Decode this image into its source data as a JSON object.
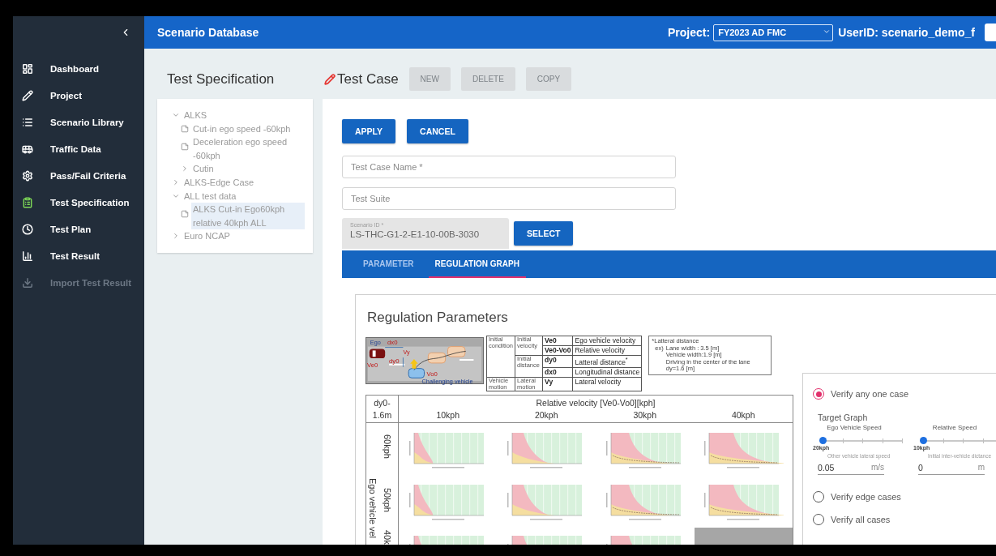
{
  "sidebar": {
    "items": [
      {
        "label": "Dashboard",
        "selected": false,
        "disabled": false
      },
      {
        "label": "Project",
        "selected": false,
        "disabled": false
      },
      {
        "label": "Scenario Library",
        "selected": false,
        "disabled": false
      },
      {
        "label": "Traffic Data",
        "selected": false,
        "disabled": false
      },
      {
        "label": "Pass/Fail Criteria",
        "selected": false,
        "disabled": false
      },
      {
        "label": "Test Specification",
        "selected": true,
        "disabled": false
      },
      {
        "label": "Test Plan",
        "selected": false,
        "disabled": false
      },
      {
        "label": "Test Result",
        "selected": false,
        "disabled": false
      },
      {
        "label": "Import Test Result",
        "selected": false,
        "disabled": true
      }
    ]
  },
  "header": {
    "title": "Scenario Database",
    "project_label": "Project:",
    "project_value": "FY2023 AD FMC",
    "user": "UserID: scenario_demo_f"
  },
  "test_specification": {
    "title": "Test Specification",
    "tree": [
      {
        "label": "ALKS",
        "kind": "folder",
        "expanded": true,
        "selected": false,
        "children": [
          {
            "label": "Cut-in ego speed -60kph",
            "kind": "doc",
            "selected": false
          },
          {
            "label": "Deceleration ego speed -60kph",
            "kind": "doc",
            "selected": false
          },
          {
            "label": "Cutin",
            "kind": "folder",
            "expanded": false,
            "selected": false
          }
        ]
      },
      {
        "label": "ALKS-Edge Case",
        "kind": "folder",
        "expanded": false,
        "selected": false
      },
      {
        "label": "ALL test data",
        "kind": "folder",
        "expanded": true,
        "selected": false,
        "children": [
          {
            "label": "ALKS Cut-in Ego60kph relative 40kph ALL",
            "kind": "doc",
            "selected": true
          }
        ]
      },
      {
        "label": "Euro NCAP",
        "kind": "folder",
        "expanded": false,
        "selected": false
      }
    ]
  },
  "test_case": {
    "title": "Test Case",
    "toolbar": [
      {
        "label": "NEW",
        "disabled": true
      },
      {
        "label": "DELETE",
        "disabled": true
      },
      {
        "label": "COPY",
        "disabled": true
      }
    ],
    "actions": [
      "APPLY",
      "CANCEL"
    ],
    "fields": [
      {
        "placeholder": "Test Case Name *"
      },
      {
        "placeholder": "Test Suite"
      }
    ],
    "scenario_id": {
      "label": "Scenario ID *",
      "value": "LS-THC-G1-2-E1-10-00B-3030"
    },
    "select_button": "SELECT",
    "tabs": [
      {
        "label": "PARAMETER",
        "selected": false
      },
      {
        "label": "REGULATION GRAPH",
        "selected": true
      }
    ]
  },
  "regulation": {
    "title": "Regulation Parameters",
    "diagram_labels": [
      "Ego",
      "dx0",
      "Ve0",
      "dy0",
      "Vy",
      "Vo0",
      "Challenging vehicle"
    ],
    "legend": [
      {
        "label": "Initial condition",
        "subgroups": [
          {
            "label": "Initial velocity",
            "rows": [
              {
                "symbol": "Ve0",
                "meaning": "Ego vehicle velocity"
              },
              {
                "symbol": "Ve0-Vo0",
                "meaning": "Relative velocity"
              }
            ]
          },
          {
            "label": "Initial distance",
            "rows": [
              {
                "symbol": "dy0",
                "meaning": "Latteral distance$^{*}$"
              },
              {
                "symbol": "dx0",
                "meaning": "Longitudinal distance"
              }
            ]
          }
        ]
      },
      {
        "label": "Vehicle motion",
        "subgroups": [
          {
            "label": "Lateral motion",
            "rows": [
              {
                "symbol": "Vy",
                "meaning": "Lateral velocity"
              }
            ]
          }
        ]
      }
    ],
    "note": {
      "title": "*Latteral distance",
      "prefix": "ex)",
      "lines": [
        "Lane width : 3.5 [m]",
        "Vehicle width:1.9 [m]",
        "Driving in the center of the lane",
        "dy=1.6 [m]"
      ]
    },
    "grid": {
      "corner": "dy0-1.6m",
      "header": "Relative velocity [Ve0-Vo0][kph]",
      "columns": [
        "10kph",
        "20kph",
        "30kph",
        "40kph"
      ],
      "axis_label": "Ego vehicle vel",
      "rows": [
        {
          "label": "60kph",
          "cells": [
            {
              "kind": "graph"
            },
            {
              "kind": "graph"
            },
            {
              "kind": "graph"
            },
            {
              "kind": "graph"
            }
          ]
        },
        {
          "label": "50kph",
          "cells": [
            {
              "kind": "graph"
            },
            {
              "kind": "graph"
            },
            {
              "kind": "graph"
            },
            {
              "kind": "graph"
            }
          ]
        },
        {
          "label": "40k",
          "cells": [
            {
              "kind": "graph"
            },
            {
              "kind": "graph"
            },
            {
              "kind": "graph"
            },
            {
              "kind": "blank"
            }
          ]
        }
      ]
    },
    "verify": {
      "options": [
        {
          "label": "Verify any one case",
          "selected": true,
          "target": {
            "title": "Target Graph",
            "sliders": [
              {
                "label": "Ego Vehicle Speed",
                "level": 0,
                "reading": "20kph"
              },
              {
                "label": "Relative Speed",
                "level": 0,
                "reading": "10kph"
              }
            ],
            "fields": [
              {
                "label": "Other vehicle lateral speed",
                "value": "0.05",
                "unit": "m/s"
              },
              {
                "label": "Initial inter-vehicle dictance",
                "value": "0",
                "unit": "m"
              }
            ]
          }
        },
        {
          "label": "Verify edge cases",
          "selected": false
        },
        {
          "label": "Verify all cases",
          "selected": false
        }
      ]
    }
  }
}
